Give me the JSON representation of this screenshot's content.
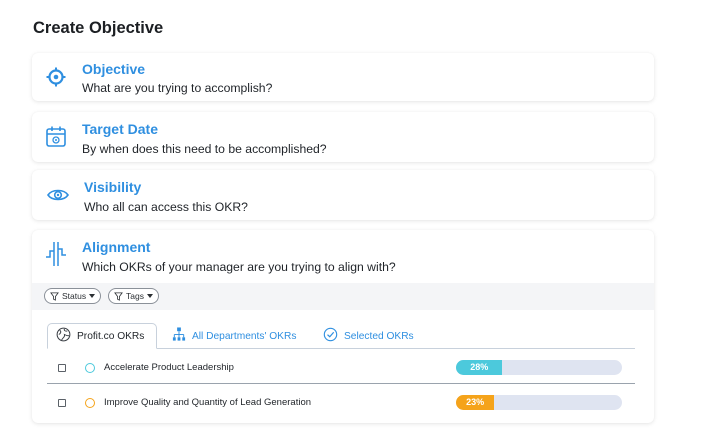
{
  "page": {
    "title": "Create Objective"
  },
  "cards": {
    "objective": {
      "title": "Objective",
      "subtitle": "What are you trying to accomplish?",
      "icon": "target-icon"
    },
    "target_date": {
      "title": "Target Date",
      "subtitle": "By when does this need to be accomplished?",
      "icon": "calendar-icon"
    },
    "visibility": {
      "title": "Visibility",
      "subtitle": "Who all can access this OKR?",
      "icon": "eye-icon"
    },
    "alignment": {
      "title": "Alignment",
      "subtitle": "Which OKRs of your manager are you trying to align with?",
      "icon": "alignment-icon"
    }
  },
  "filters": {
    "status": "Status",
    "tags": "Tags"
  },
  "tabs": [
    {
      "label": "Profit.co OKRs",
      "icon": "globe-icon",
      "active": true
    },
    {
      "label": "All Departments' OKRs",
      "icon": "org-chart-icon",
      "active": false
    },
    {
      "label": "Selected OKRs",
      "icon": "check-circle-icon",
      "active": false
    }
  ],
  "okrs": [
    {
      "title": "Accelerate Product Leadership",
      "progress": 28,
      "progress_label": "28%",
      "color": "#4cc9dc"
    },
    {
      "title": "Improve Quality and Quantity of Lead Generation",
      "progress": 23,
      "progress_label": "23%",
      "color": "#f5a31a"
    }
  ],
  "colors": {
    "accent": "#2f8fe0",
    "progress_track": "#dfe4f1"
  }
}
